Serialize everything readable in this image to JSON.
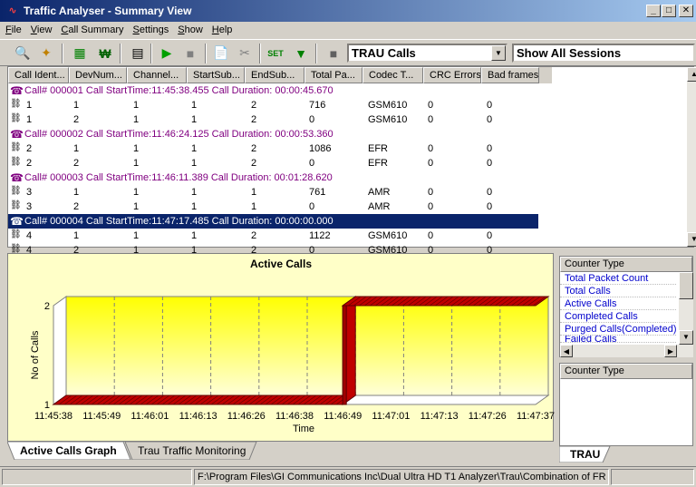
{
  "window": {
    "title": "Traffic Analyser - Summary View",
    "min": "_",
    "max": "□",
    "close": "✕"
  },
  "menu": [
    "File",
    "View",
    "Call Summary",
    "Settings",
    "Show",
    "Help"
  ],
  "toolbar": {
    "combo_value": "TRAU Calls",
    "sessions_value": "Show All Sessions"
  },
  "table": {
    "columns": [
      "Call Ident...",
      "DevNum...",
      "Channel...",
      "StartSub...",
      "EndSub...",
      "Total Pa...",
      "Codec T...",
      "CRC Errors",
      "Bad frames"
    ],
    "calls": [
      {
        "header": "Call# 000001 Call StartTime:11:45:38.455 Call Duration: 00:00:45.670",
        "rows": [
          [
            "1",
            "1",
            "1",
            "1",
            "2",
            "716",
            "GSM610",
            "0",
            "0"
          ],
          [
            "1",
            "2",
            "1",
            "1",
            "2",
            "0",
            "GSM610",
            "0",
            "0"
          ]
        ]
      },
      {
        "header": "Call# 000002 Call StartTime:11:46:24.125 Call Duration: 00:00:53.360",
        "rows": [
          [
            "2",
            "1",
            "1",
            "1",
            "2",
            "1086",
            "EFR",
            "0",
            "0"
          ],
          [
            "2",
            "2",
            "1",
            "1",
            "2",
            "0",
            "EFR",
            "0",
            "0"
          ]
        ]
      },
      {
        "header": "Call# 000003 Call StartTime:11:46:11.389 Call Duration: 00:01:28.620",
        "rows": [
          [
            "3",
            "1",
            "1",
            "1",
            "1",
            "761",
            "AMR",
            "0",
            "0"
          ],
          [
            "3",
            "2",
            "1",
            "1",
            "1",
            "0",
            "AMR",
            "0",
            "0"
          ]
        ]
      },
      {
        "header": "Call# 000004 Call StartTime:11:47:17.485 Call Duration: 00:00:00.000",
        "rows": [
          [
            "4",
            "1",
            "1",
            "1",
            "2",
            "1122",
            "GSM610",
            "0",
            "0"
          ],
          [
            "4",
            "2",
            "1",
            "1",
            "2",
            "0",
            "GSM610",
            "0",
            "0"
          ]
        ]
      }
    ]
  },
  "chart_data": {
    "type": "area",
    "title": "Active Calls",
    "xlabel": "Time",
    "ylabel": "No of Calls",
    "x_ticks": [
      "11:45:38",
      "11:45:49",
      "11:46:01",
      "11:46:13",
      "11:46:26",
      "11:46:38",
      "11:46:49",
      "11:47:01",
      "11:47:13",
      "11:47:26",
      "11:47:37"
    ],
    "y_ticks": [
      "1",
      "2"
    ],
    "ylim": [
      1,
      2
    ],
    "series": [
      {
        "x": [
          "11:45:38",
          "11:46:49",
          "11:46:49",
          "11:47:37"
        ],
        "values": [
          1,
          1,
          2,
          2
        ]
      }
    ],
    "colors": {
      "fill": "#c00000",
      "background": "#ffffc8"
    }
  },
  "tabs": [
    "Active Calls Graph",
    "Trau Traffic Monitoring"
  ],
  "counter_panel": {
    "header": "Counter Type",
    "items": [
      "Total Packet Count",
      "Total Calls",
      "Active Calls",
      "Completed Calls",
      "Purged Calls(Completed)",
      "Failed Calls"
    ],
    "header2": "Counter Type",
    "tab": "TRAU"
  },
  "status": {
    "path": "F:\\Program Files\\GI Communications Inc\\Dual Ultra HD T1 Analyzer\\Trau\\Combination of FR and"
  }
}
